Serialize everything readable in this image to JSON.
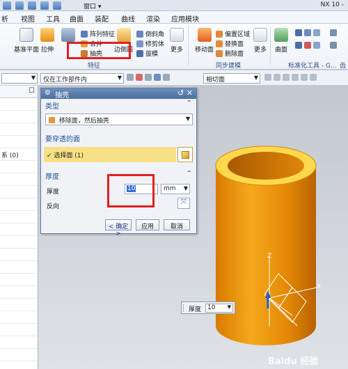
{
  "titlebar": {
    "window_menu": "窗口 ▾",
    "app_title": "NX 10 -"
  },
  "menu": {
    "tabs": [
      "析",
      "视图",
      "工具",
      "曲面",
      "装配",
      "曲线",
      "渲染",
      "应用模块"
    ]
  },
  "ribbon": {
    "datum_plane": "基准平面",
    "extrude": "拉伸",
    "pattern_feature": "阵列特征",
    "unite": "合并",
    "shell": "抽壳",
    "edge_blend": "边倒圆",
    "chamfer": "倒斜角",
    "trim_body": "修剪体",
    "draft": "拔模",
    "more1": "更多",
    "move_face": "移动面",
    "offset_region": "偏置区域",
    "replace_face": "替换面",
    "delete_face": "删除面",
    "more2": "更多",
    "surface": "曲面",
    "group_feature": "特征",
    "group_sync": "同步建模",
    "group_std": "标准化工具 - G...",
    "group_more": "齿"
  },
  "filterbar": {
    "filter1": "",
    "filter2": "仅在工作部件内",
    "filter3": "相切面"
  },
  "navigator": {
    "item_label": "系 (0)"
  },
  "dialog": {
    "title": "抽壳",
    "type_section": "类型",
    "type_value": "移除面，然后抽壳",
    "faces_section": "要穿透的面",
    "faces_value": "选择面 (1)",
    "thickness_section": "厚度",
    "thickness_label": "厚度",
    "thickness_value": "10",
    "thickness_unit": "mm",
    "reverse_label": "反向",
    "ok": "< 确定 >",
    "apply": "应用",
    "cancel": "取消"
  },
  "viewport": {
    "thickness_popup_label": "厚度",
    "thickness_popup_value": "10",
    "axis_z": "Z",
    "axis_x": "X",
    "watermark": "Baidu 经验"
  },
  "colors": {
    "cylinder": "#f09a0c",
    "cylinder_dark": "#c06b00",
    "accent_yellow": "#ffd84d",
    "highlight_red": "#e02020",
    "dialog_title": "#4a6e9f"
  }
}
